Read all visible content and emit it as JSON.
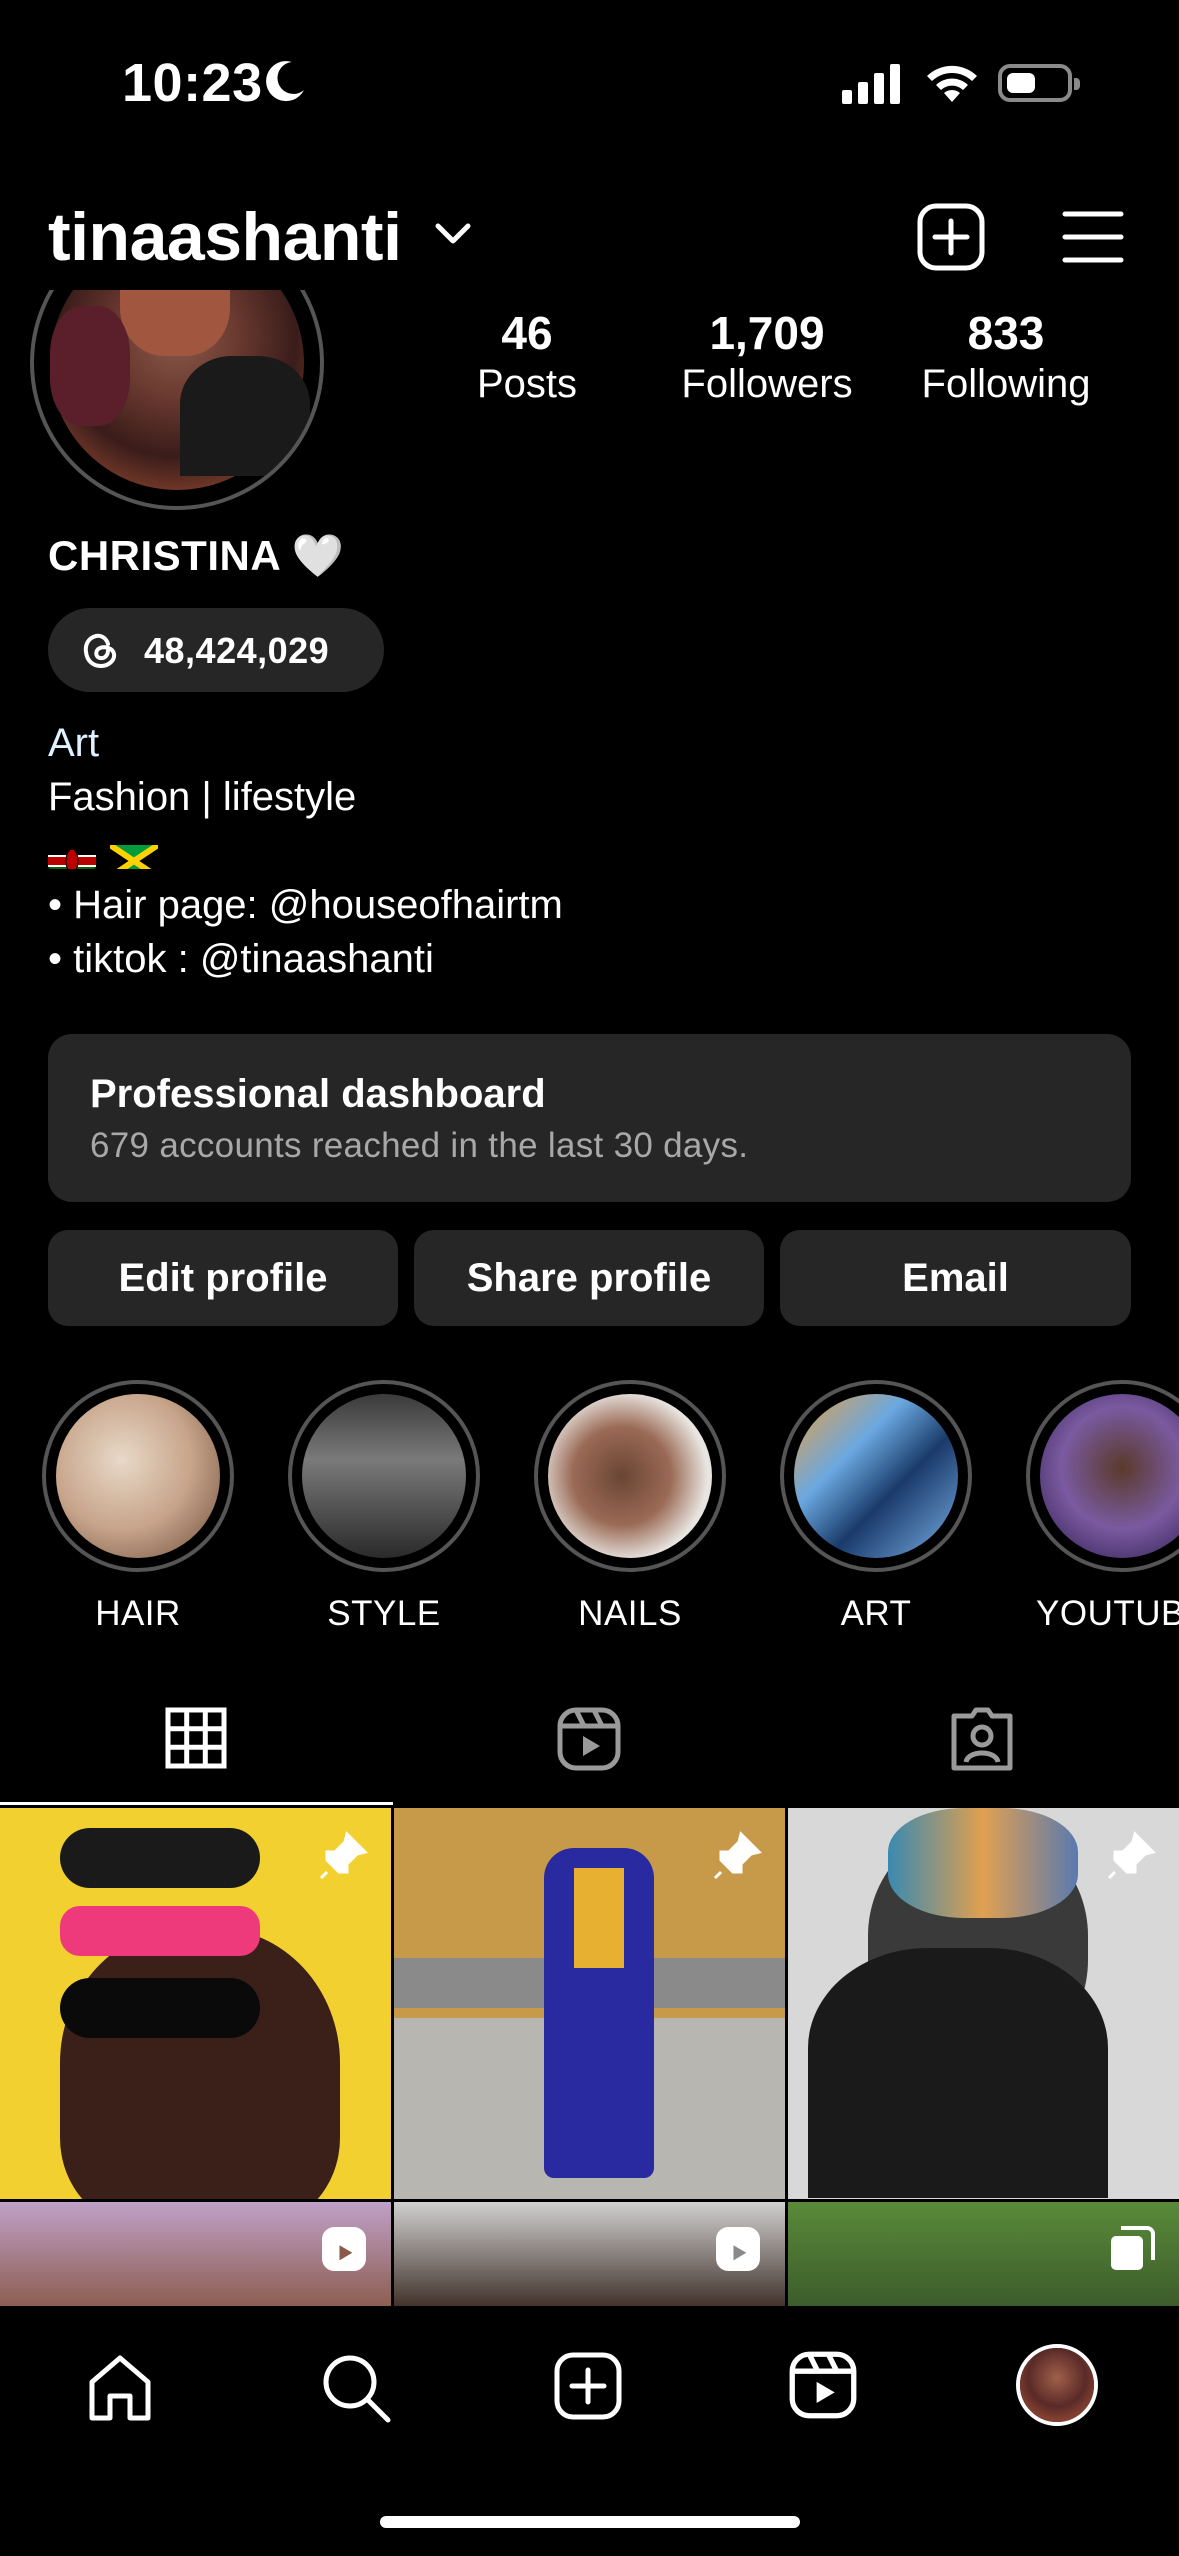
{
  "status_bar": {
    "time": "10:23",
    "moon_icon": "moon-icon",
    "signal_icon": "cellular-signal-icon",
    "wifi_icon": "wifi-icon",
    "battery_icon": "battery-icon"
  },
  "header": {
    "username": "tinaashanti",
    "chevron_icon": "chevron-down-icon",
    "create_icon": "plus-square-icon",
    "menu_icon": "hamburger-menu-icon"
  },
  "profile": {
    "stats": [
      {
        "value": "46",
        "label": "Posts"
      },
      {
        "value": "1,709",
        "label": "Followers"
      },
      {
        "value": "833",
        "label": "Following"
      }
    ],
    "name": "CHRISTINA 🤍",
    "threads_count": "48,424,029",
    "bio": {
      "category": "Art",
      "line1": "Fashion | lifestyle",
      "line3": "• Hair page: @houseofhairtm",
      "line4": "• tiktok : @tinaashanti"
    }
  },
  "dashboard": {
    "title": "Professional dashboard",
    "subtitle": "679 accounts reached in the last 30 days."
  },
  "buttons": {
    "edit": "Edit profile",
    "share": "Share profile",
    "email": "Email"
  },
  "highlights": [
    {
      "label": "HAIR"
    },
    {
      "label": "STYLE"
    },
    {
      "label": "NAILS"
    },
    {
      "label": "ART"
    },
    {
      "label": "YOUTUBE"
    }
  ],
  "tabs": [
    {
      "icon": "grid-icon",
      "active": true
    },
    {
      "icon": "reels-icon",
      "active": false
    },
    {
      "icon": "tagged-icon",
      "active": false
    }
  ],
  "grid": [
    {
      "pinned": true,
      "overlay": "pin-icon"
    },
    {
      "pinned": true,
      "overlay": "pin-icon"
    },
    {
      "pinned": true,
      "overlay": "pin-icon"
    },
    {
      "overlay": "reel-icon"
    },
    {
      "overlay": "reel-icon"
    },
    {
      "overlay": "carousel-icon"
    }
  ],
  "bottom_nav": [
    "home-icon",
    "search-icon",
    "create-icon",
    "reels-icon",
    "profile-avatar"
  ]
}
